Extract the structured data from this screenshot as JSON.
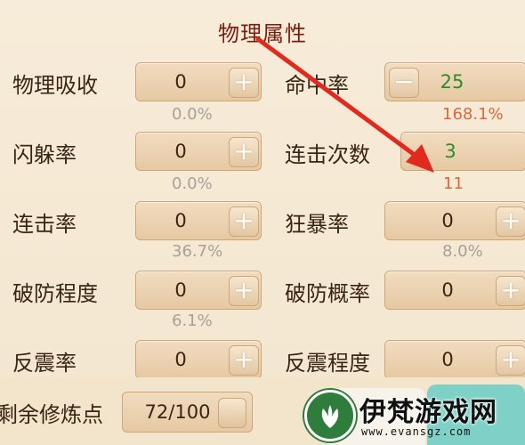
{
  "section": {
    "title": "物理属性"
  },
  "stats": {
    "physical_absorb": {
      "label": "物理吸收",
      "value": "0",
      "button": "+",
      "percent": "0.0%"
    },
    "hit_rate": {
      "label": "命中率",
      "value": "25",
      "button": "−",
      "percent": "168.1%"
    },
    "dodge_rate": {
      "label": "闪躲率",
      "value": "0",
      "button": "+",
      "percent": "0.0%"
    },
    "combo_count": {
      "label": "连击次数",
      "value": "3",
      "percent": "11"
    },
    "combo_rate": {
      "label": "连击率",
      "value": "0",
      "button": "+",
      "percent": "36.7%"
    },
    "rage_rate": {
      "label": "狂暴率",
      "value": "0",
      "button": "+",
      "percent": "8.0%"
    },
    "armor_break_level": {
      "label": "破防程度",
      "value": "0",
      "button": "+",
      "percent": "6.1%"
    },
    "armor_break_rate": {
      "label": "破防概率",
      "value": "0",
      "button": "+"
    },
    "counter_rate": {
      "label": "反震率",
      "value": "0",
      "button": "+"
    },
    "counter_level": {
      "label": "反震程度",
      "value": "0",
      "button": "+"
    }
  },
  "footer": {
    "remaining_label": "剩余修炼点",
    "remaining_value": "72/100"
  },
  "watermark": {
    "title": "伊梵游戏网",
    "url": "www.evansgz.com"
  },
  "colors": {
    "arrow": "#e02a1e",
    "green_value": "#2e8b2e",
    "orange_value": "#d9683a",
    "muted_percent": "#a8a09a"
  }
}
